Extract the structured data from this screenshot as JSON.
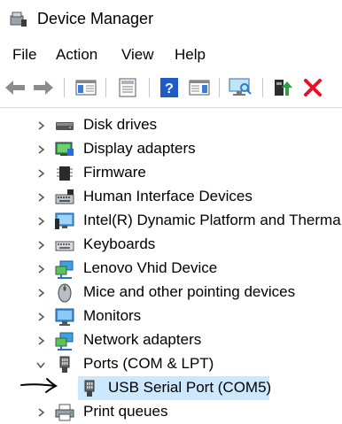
{
  "window": {
    "title": "Device Manager"
  },
  "menu": [
    {
      "label": "File"
    },
    {
      "label": "Action"
    },
    {
      "label": "View"
    },
    {
      "label": "Help"
    }
  ],
  "toolbar": [
    {
      "icon": "back-arrow-icon"
    },
    {
      "icon": "forward-arrow-icon"
    },
    {
      "icon": "show-hide-console-tree-icon"
    },
    {
      "icon": "properties-icon"
    },
    {
      "icon": "help-icon"
    },
    {
      "icon": "action-pane-icon"
    },
    {
      "icon": "scan-hardware-changes-icon"
    },
    {
      "icon": "update-driver-icon"
    },
    {
      "icon": "uninstall-device-icon"
    }
  ],
  "tree": {
    "items": [
      {
        "label": "Disk drives",
        "icon": "disk-drive-icon",
        "expanded": false
      },
      {
        "label": "Display adapters",
        "icon": "display-adapter-icon",
        "expanded": false
      },
      {
        "label": "Firmware",
        "icon": "firmware-chip-icon",
        "expanded": false
      },
      {
        "label": "Human Interface Devices",
        "icon": "hid-keyboard-icon",
        "expanded": false
      },
      {
        "label": "Intel(R) Dynamic Platform and Therma",
        "icon": "intel-monitor-icon",
        "expanded": false
      },
      {
        "label": "Keyboards",
        "icon": "keyboard-icon",
        "expanded": false
      },
      {
        "label": "Lenovo Vhid Device",
        "icon": "network-monitor-icon",
        "expanded": false
      },
      {
        "label": "Mice and other pointing devices",
        "icon": "mouse-icon",
        "expanded": false
      },
      {
        "label": "Monitors",
        "icon": "monitor-icon",
        "expanded": false
      },
      {
        "label": "Network adapters",
        "icon": "network-adapter-icon",
        "expanded": false
      },
      {
        "label": "Ports (COM & LPT)",
        "icon": "port-connector-icon",
        "expanded": true
      },
      {
        "label": "USB Serial Port (COM5)",
        "icon": "port-connector-icon",
        "child": true,
        "selected": true
      },
      {
        "label": "Print queues",
        "icon": "printer-icon",
        "expanded": false
      }
    ]
  },
  "colors": {
    "selection": "#cce8ff",
    "accent_blue": "#1e6fd9",
    "red_x": "#e81123"
  }
}
